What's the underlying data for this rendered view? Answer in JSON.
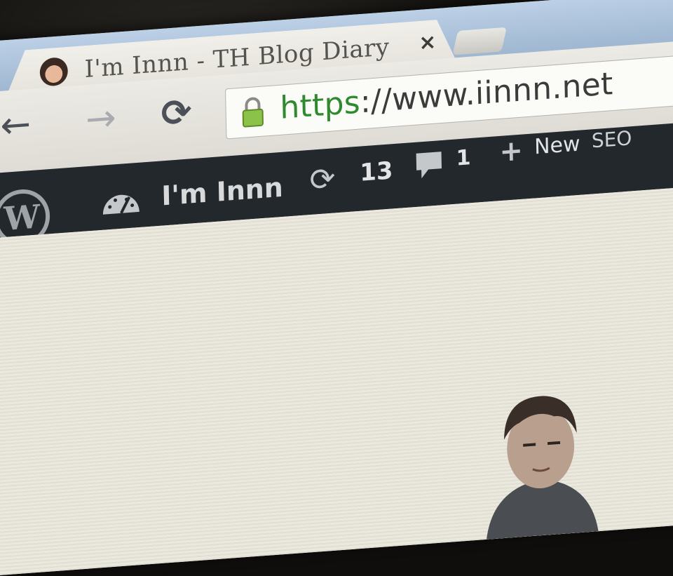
{
  "browser": {
    "tab": {
      "title": "I'm Innn - TH Blog Diary",
      "close_label": "×"
    },
    "toolbar": {
      "back_label": "←",
      "forward_label": "→",
      "reload_label": "⟳"
    },
    "omnibox": {
      "url_scheme": "https",
      "url_rest": "://www.iinnn.net"
    }
  },
  "admin_bar": {
    "logo_label": "W",
    "site_name": "I'm Innn",
    "updates_icon": "⟳",
    "updates_count": "13",
    "comments_count": "1",
    "new_icon": "+",
    "new_label": "New",
    "seo_label": "SEO"
  },
  "colors": {
    "admin_bar": "#23282d",
    "secure_scheme": "#2f8a2f",
    "lock": "#8bc34a"
  }
}
